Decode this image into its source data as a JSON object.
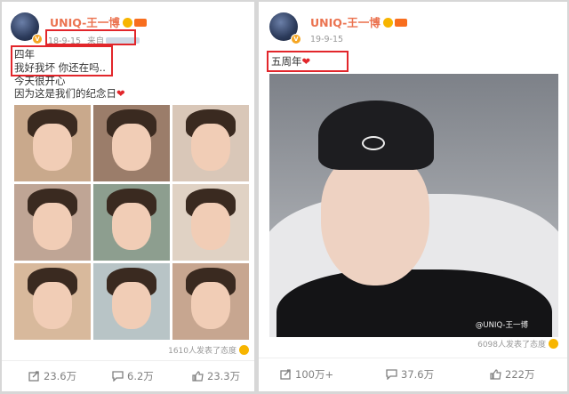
{
  "left_post": {
    "user": {
      "name": "UNIQ-王一博"
    },
    "meta": {
      "date": "18-9-15",
      "source_label": "来自"
    },
    "text": {
      "line1": "四年",
      "line2": "我好我坏 你还在吗..",
      "line3": "今天很开心",
      "line4": "因为这是我们的纪念日",
      "heart": "❤"
    },
    "reactions": "1610人发表了态度",
    "actions": {
      "forward": "23.6万",
      "comment": "6.2万",
      "like": "23.3万"
    }
  },
  "right_post": {
    "user": {
      "name": "UNIQ-王一博"
    },
    "meta": {
      "date": "19-9-15"
    },
    "text": {
      "line1": "五周年",
      "heart": "❤"
    },
    "watermark": "@UNIQ-王一博",
    "reactions": "6098人发表了态度",
    "actions": {
      "forward": "100万+",
      "comment": "37.6万",
      "like": "222万"
    }
  },
  "icons": {
    "verified": "verified-badge-icon",
    "forward": "forward-icon",
    "comment": "comment-icon",
    "like": "like-icon",
    "smile": "smile-emoji-icon"
  },
  "colors": {
    "username": "#eb7350",
    "highlight_box": "#e2262b",
    "heart": "#e2262b"
  }
}
